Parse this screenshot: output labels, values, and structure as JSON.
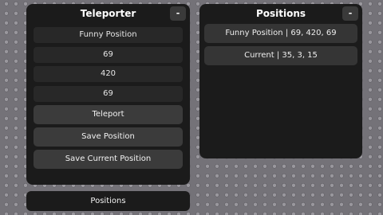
{
  "teleporter": {
    "title": "Teleporter",
    "minimize_label": "-",
    "fields": {
      "name": "Funny Position",
      "x": "69",
      "y": "420",
      "z": "69"
    },
    "buttons": {
      "teleport": "Teleport",
      "save_position": "Save Position",
      "save_current": "Save Current Position"
    }
  },
  "positions_panel": {
    "title": "Positions",
    "minimize_label": "-",
    "items": [
      "Funny Position | 69, 420, 69",
      "Current | 35, 3, 15"
    ]
  },
  "positions_toggle": {
    "label": "Positions"
  }
}
